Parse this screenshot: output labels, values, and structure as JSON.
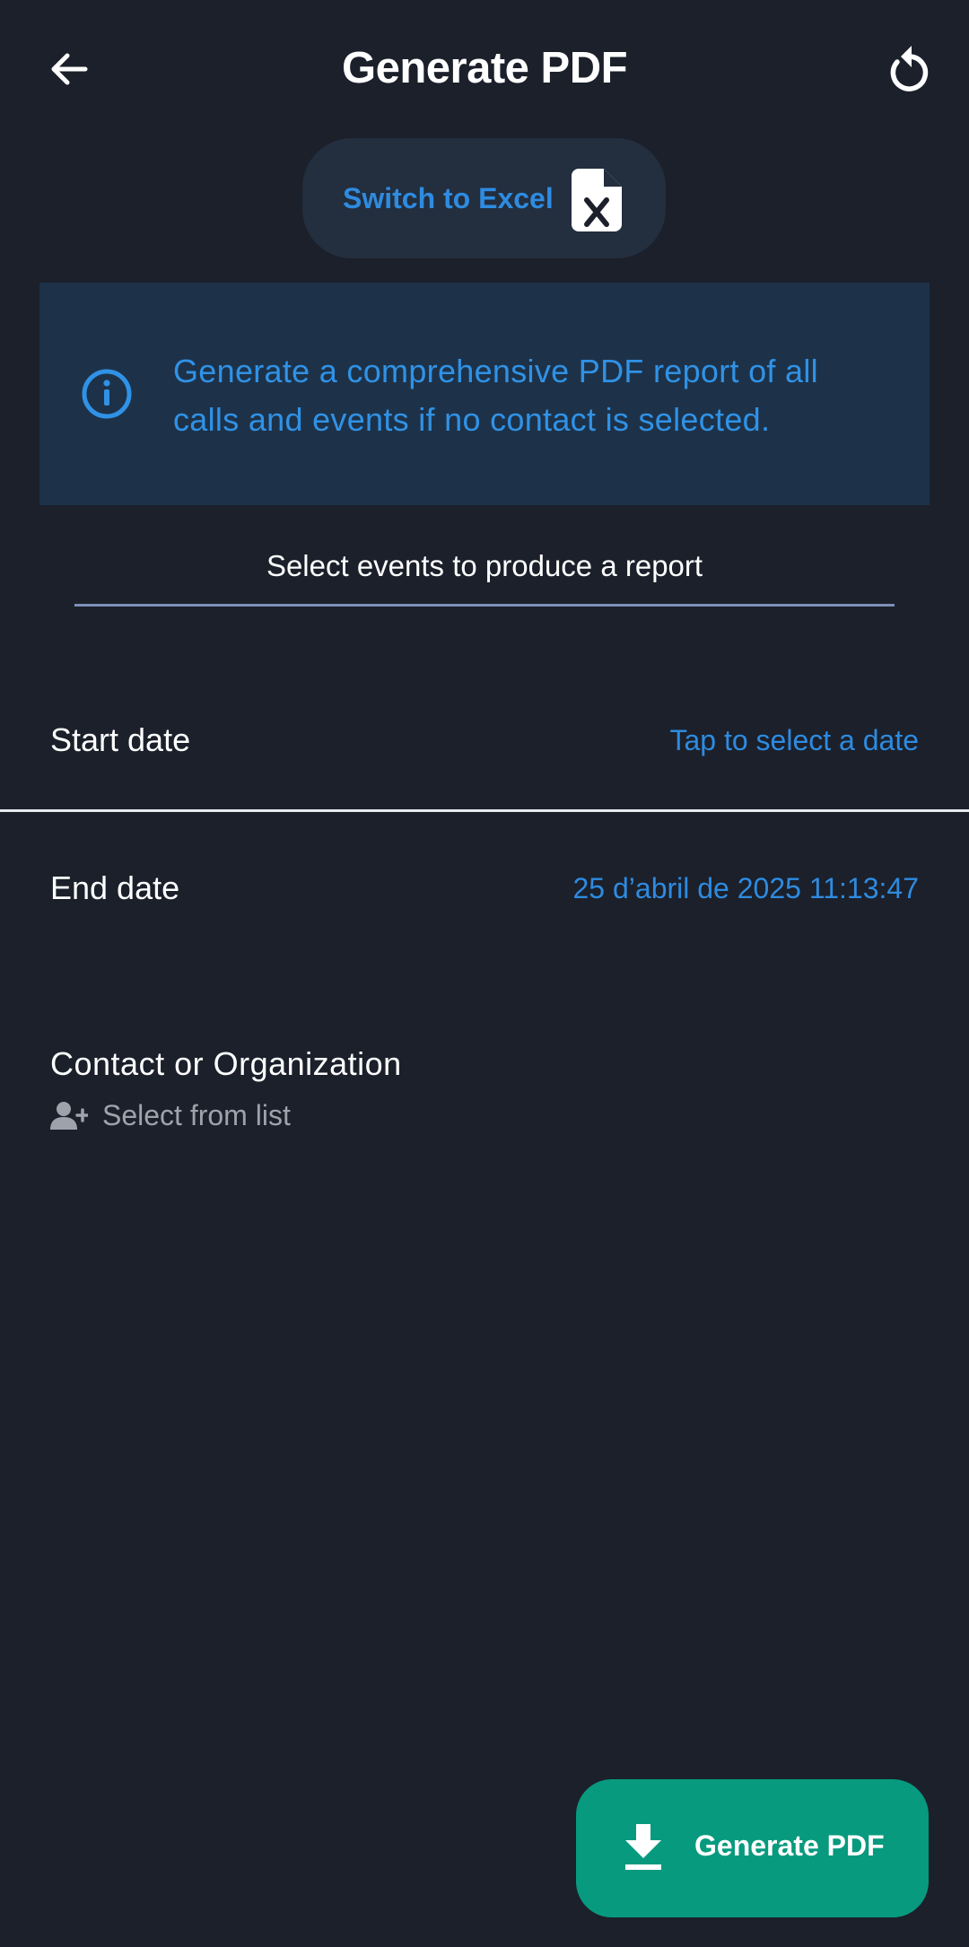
{
  "app_bar": {
    "title": "Generate PDF",
    "back_icon": "arrow-left-icon",
    "refresh_icon": "refresh-icon"
  },
  "switch_button": {
    "label": "Switch to Excel",
    "icon": "excel-file-icon"
  },
  "info_banner": {
    "icon": "info-icon",
    "text": "Generate a comprehensive PDF report of all calls and events if no contact is selected."
  },
  "events_select": {
    "label": "Select events to produce a report"
  },
  "start_date": {
    "label": "Start date",
    "value": "Tap to select a date"
  },
  "end_date": {
    "label": "End date",
    "value": "25 d’abril de 2025 11:13:47"
  },
  "contact": {
    "title": "Contact or Organization",
    "hint": "Select from list",
    "hint_icon": "add-contact-icon"
  },
  "fab": {
    "label": "Generate PDF",
    "icon": "download-icon"
  },
  "colors": {
    "background": "#1b202b",
    "accent": "#2e8be0",
    "banner": "#1d3249",
    "fab": "#079a7e"
  }
}
